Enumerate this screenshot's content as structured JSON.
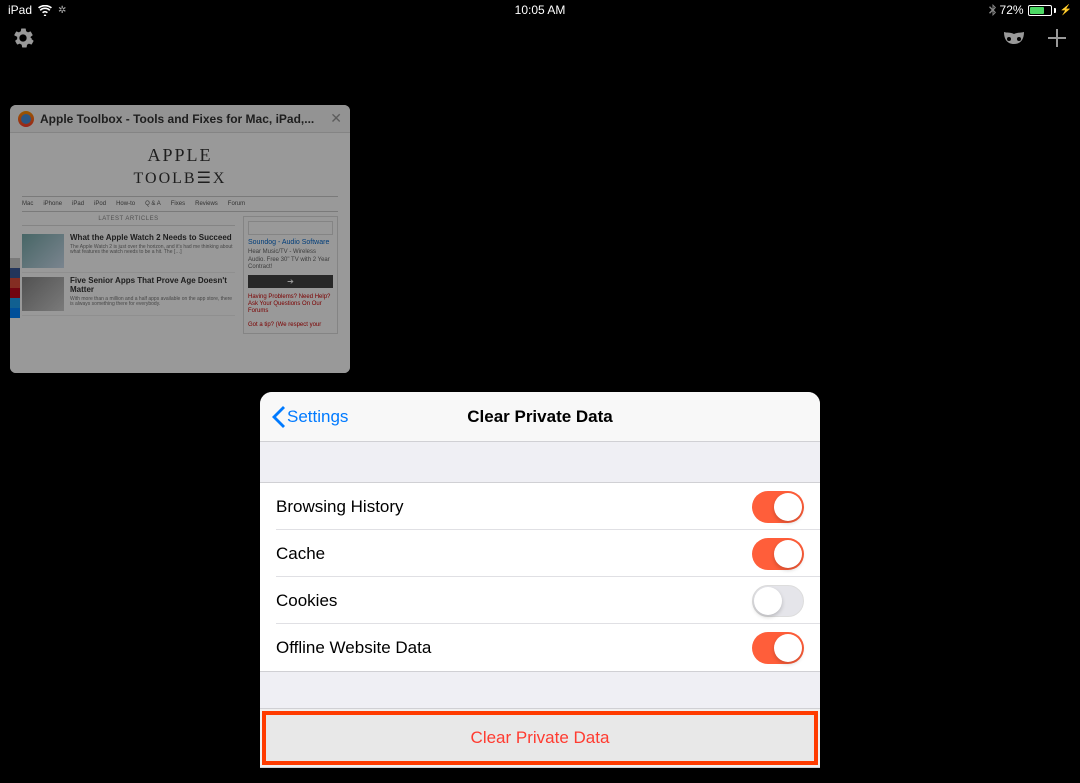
{
  "status": {
    "device": "iPad",
    "time": "10:05 AM",
    "battery_pct": "72%",
    "battery_fill": 72
  },
  "tab": {
    "title": "Apple Toolbox - Tools and Fixes for Mac, iPad,...",
    "preview": {
      "logo1": "APPLE",
      "logo2": "TOOLB☰X",
      "nav": [
        "Mac",
        "iPhone",
        "iPad",
        "iPod",
        "How-to",
        "Q & A",
        "Fixes",
        "Reviews",
        "Forum"
      ],
      "section_label": "LATEST ARTICLES",
      "articles": [
        {
          "title": "What the Apple Watch 2 Needs to Succeed",
          "desc": "The Apple Watch 2 is just over the horizon, and it's had me thinking about what features the watch needs to be a hit. The […]"
        },
        {
          "title": "Five Senior Apps That Prove Age Doesn't Matter",
          "desc": "With more than a million and a half apps available on the app store, there is always something there for everybody."
        }
      ],
      "sidebar": {
        "ad_title": "Soundog - Audio Software",
        "ad_text": "Hear Music/TV - Wireless Audio. Free 30\" TV with 2 Year Contract!",
        "arrow": "➔",
        "help1": "Having Problems? Need Help? Ask Your Questions On Our Forums",
        "help2": "Got a tip? (We respect your"
      }
    }
  },
  "modal": {
    "back_label": "Settings",
    "title": "Clear Private Data",
    "rows": [
      {
        "label": "Browsing History",
        "on": true
      },
      {
        "label": "Cache",
        "on": true
      },
      {
        "label": "Cookies",
        "on": false
      },
      {
        "label": "Offline Website Data",
        "on": true
      }
    ],
    "action_label": "Clear Private Data"
  },
  "colors": {
    "toggle_on": "#ff5e3a",
    "accent_blue": "#007aff",
    "destructive": "#ff3b30",
    "highlight_border": "#ff3b00"
  }
}
